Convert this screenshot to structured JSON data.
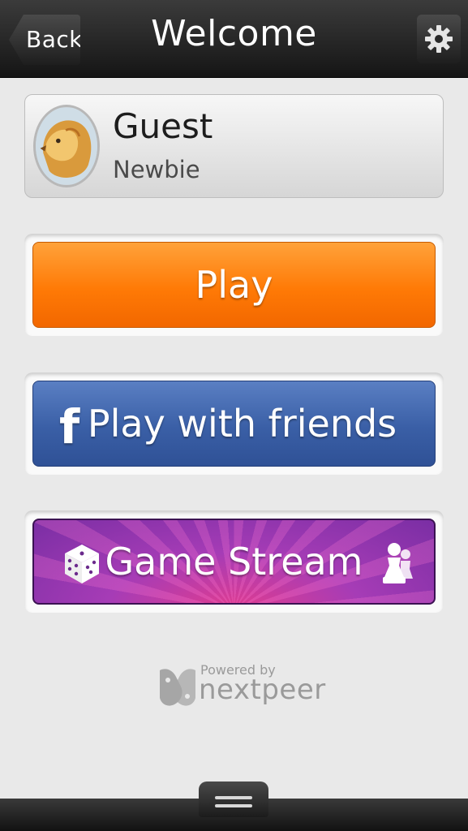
{
  "header": {
    "back_label": "Back",
    "title": "Welcome",
    "settings_icon": "gear-icon"
  },
  "profile": {
    "name": "Guest",
    "rank": "Newbie",
    "avatar_icon": "lion-avatar"
  },
  "buttons": {
    "play": "Play",
    "play_with_friends": "Play with friends",
    "game_stream": "Game Stream"
  },
  "footer": {
    "powered_by": "Powered by",
    "brand": "nextpeer"
  },
  "colors": {
    "play": "#ff7a06",
    "friends": "#3a5fa6",
    "stream": "#a63cb6"
  }
}
